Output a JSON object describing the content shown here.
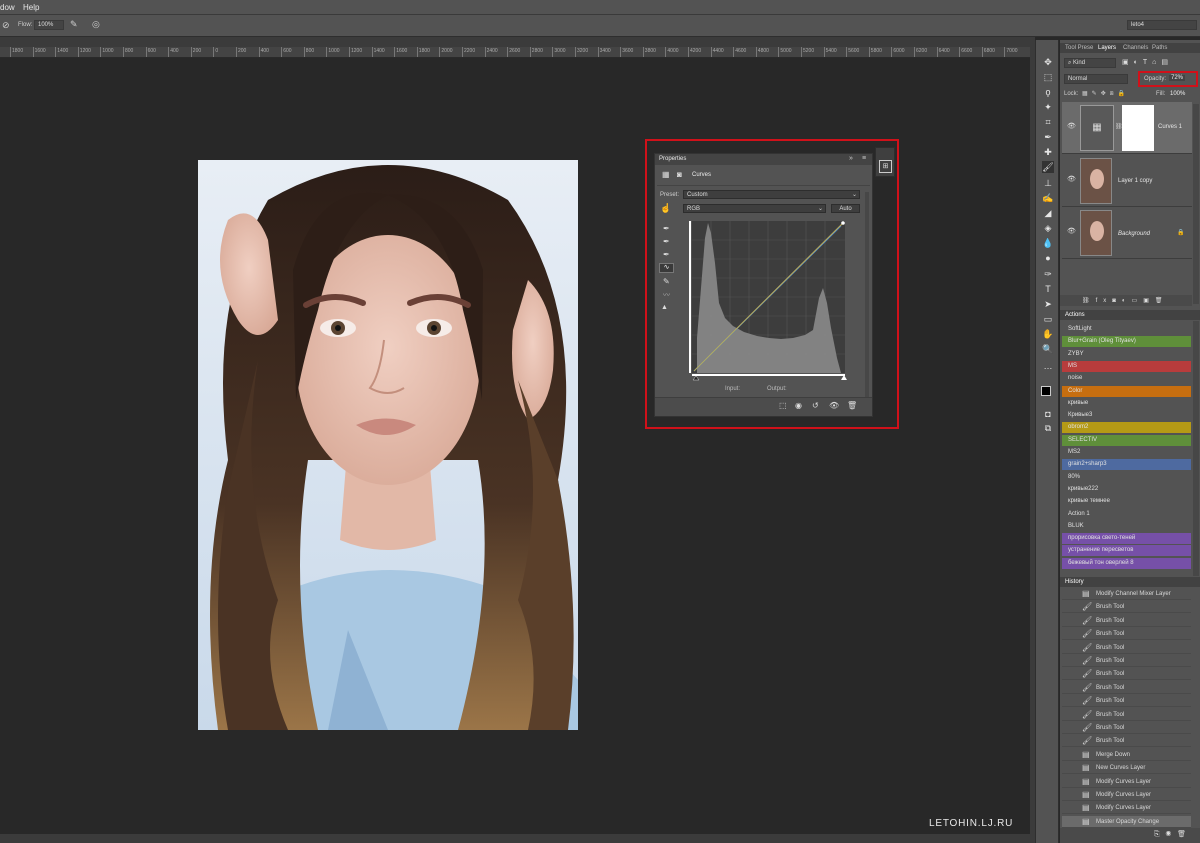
{
  "menubar": {
    "window": "dow",
    "help": "Help"
  },
  "options": {
    "flow_label": "Flow:",
    "flow_value": "100%",
    "workspace": "leto4"
  },
  "ruler_ticks": [
    "1800",
    "1600",
    "1400",
    "1200",
    "1000",
    "800",
    "600",
    "400",
    "200",
    "0",
    "200",
    "400",
    "600",
    "800",
    "1000",
    "1200",
    "1400",
    "1600",
    "1800",
    "2000",
    "2200",
    "2400",
    "2600",
    "2800",
    "3000",
    "3200",
    "3400",
    "3600",
    "3800",
    "4000",
    "4200",
    "4400",
    "4600",
    "4800",
    "5000",
    "5200",
    "5400",
    "5600",
    "5800",
    "6000",
    "6200",
    "6400",
    "6600",
    "6800",
    "7000"
  ],
  "properties": {
    "tab": "Properties",
    "title": "Curves",
    "preset_label": "Preset:",
    "preset_value": "Custom",
    "channel": "RGB",
    "auto": "Auto",
    "input_label": "Input:",
    "output_label": "Output:"
  },
  "panel_tabs": {
    "tool_presets": "Tool Prese",
    "layers": "Layers",
    "channels": "Channels",
    "paths": "Paths"
  },
  "layers_panel": {
    "kind": "Kind",
    "blend_mode": "Normal",
    "opacity_label": "Opacity:",
    "opacity_value": "72%",
    "lock_label": "Lock:",
    "fill_label": "Fill:",
    "fill_value": "100%",
    "layers": [
      {
        "name": "Curves 1"
      },
      {
        "name": "Layer 1 copy"
      },
      {
        "name": "Background"
      }
    ]
  },
  "actions_panel": {
    "title": "Actions",
    "items": [
      {
        "label": "SoftLight",
        "color": ""
      },
      {
        "label": "Blur+Grain (Oleg Tityaev)",
        "color": "#5f8f3a"
      },
      {
        "label": "ZYBY",
        "color": ""
      },
      {
        "label": "MS",
        "color": "#b83c3c"
      },
      {
        "label": "noise",
        "color": ""
      },
      {
        "label": "Color",
        "color": "#c66e10"
      },
      {
        "label": "кривые",
        "color": ""
      },
      {
        "label": "Кривые3",
        "color": ""
      },
      {
        "label": "obrom2",
        "color": "#b59a16"
      },
      {
        "label": "SELECTIV",
        "color": "#5f8f3a"
      },
      {
        "label": "MS2",
        "color": ""
      },
      {
        "label": "grain2+sharp3",
        "color": "#4e6aa0"
      },
      {
        "label": "80%",
        "color": ""
      },
      {
        "label": "кривые222",
        "color": ""
      },
      {
        "label": "кривые темнее",
        "color": ""
      },
      {
        "label": "Action 1",
        "color": ""
      },
      {
        "label": "BLUK",
        "color": ""
      },
      {
        "label": "прорисовка свето-теней",
        "color": "#7650a8"
      },
      {
        "label": "устранение пересветов",
        "color": "#7650a8"
      },
      {
        "label": "бежевый тон оверлей 8",
        "color": "#7650a8"
      }
    ]
  },
  "history_panel": {
    "title": "History",
    "items": [
      {
        "label": "Modify Channel Mixer Layer",
        "icon": "document-icon"
      },
      {
        "label": "Brush Tool",
        "icon": "brush-icon"
      },
      {
        "label": "Brush Tool",
        "icon": "brush-icon"
      },
      {
        "label": "Brush Tool",
        "icon": "brush-icon"
      },
      {
        "label": "Brush Tool",
        "icon": "brush-icon"
      },
      {
        "label": "Brush Tool",
        "icon": "brush-icon"
      },
      {
        "label": "Brush Tool",
        "icon": "brush-icon"
      },
      {
        "label": "Brush Tool",
        "icon": "brush-icon"
      },
      {
        "label": "Brush Tool",
        "icon": "brush-icon"
      },
      {
        "label": "Brush Tool",
        "icon": "brush-icon"
      },
      {
        "label": "Brush Tool",
        "icon": "brush-icon"
      },
      {
        "label": "Brush Tool",
        "icon": "brush-icon"
      },
      {
        "label": "Merge Down",
        "icon": "document-icon"
      },
      {
        "label": "New Curves Layer",
        "icon": "document-icon"
      },
      {
        "label": "Modify Curves Layer",
        "icon": "document-icon"
      },
      {
        "label": "Modify Curves Layer",
        "icon": "document-icon"
      },
      {
        "label": "Modify Curves Layer",
        "icon": "document-icon"
      },
      {
        "label": "Master Opacity Change",
        "icon": "document-icon"
      }
    ]
  },
  "watermark": "LETOHIN.LJ.RU",
  "colors": {
    "highlight": "#d0111a",
    "panel": "#535353",
    "canvas": "#282828"
  }
}
